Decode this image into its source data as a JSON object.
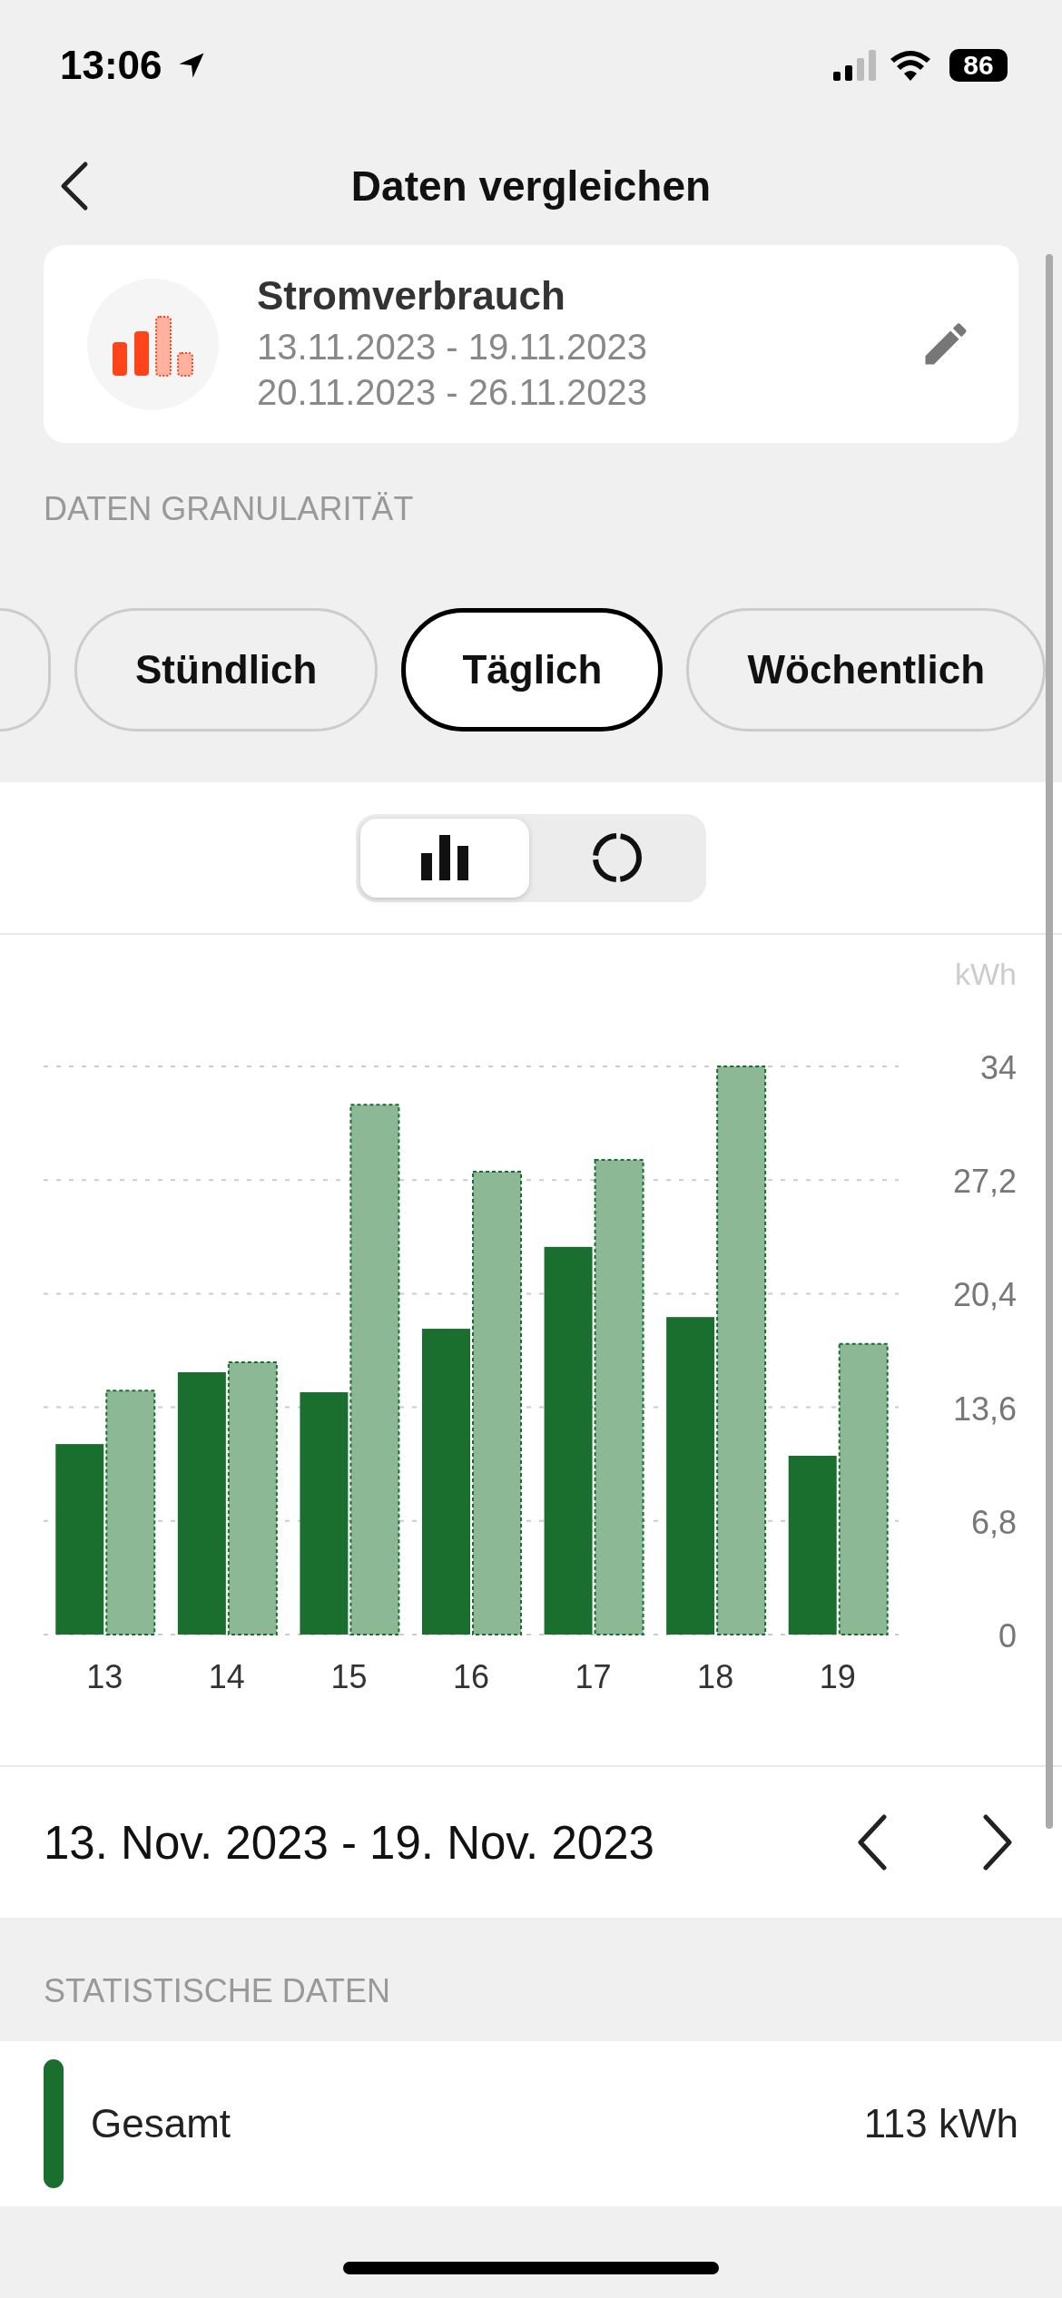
{
  "status_bar": {
    "time": "13:06",
    "battery": "86"
  },
  "nav": {
    "title": "Daten vergleichen"
  },
  "comparison": {
    "title": "Stromverbrauch",
    "periods": [
      "13.11.2023 - 19.11.2023",
      "20.11.2023 - 26.11.2023"
    ]
  },
  "granularity": {
    "label": "DATEN GRANULARITÄT",
    "options": [
      {
        "label": "Stündlich",
        "selected": false
      },
      {
        "label": "Täglich",
        "selected": true
      },
      {
        "label": "Wöchentlich",
        "selected": false
      }
    ]
  },
  "view_toggle": [
    {
      "kind": "bar",
      "selected": true
    },
    {
      "kind": "donut",
      "selected": false
    }
  ],
  "chart": {
    "chart_data": {
      "type": "bar",
      "grid": true,
      "ylabel": "kWh",
      "categories": [
        "13",
        "14",
        "15",
        "16",
        "17",
        "18",
        "19"
      ],
      "series": [
        {
          "color": "#1a6e2e",
          "values": [
            11.4,
            15.7,
            14.5,
            18.3,
            23.2,
            19.0,
            10.7
          ]
        },
        {
          "color": "#8cb896",
          "values": [
            14.6,
            16.3,
            31.7,
            27.7,
            28.4,
            34.0,
            17.4
          ]
        }
      ],
      "ylim": [
        0,
        34
      ],
      "yticks": [
        0,
        {
          "value": 6.8,
          "label": "6,8"
        },
        {
          "value": 13.6,
          "label": "13,6"
        },
        {
          "value": 20.4,
          "label": "20,4"
        },
        {
          "value": 27.2,
          "label": "27,2"
        },
        34
      ]
    }
  },
  "range": {
    "text": "13. Nov. 2023 - 19. Nov. 2023"
  },
  "statistics": {
    "label": "STATISTISCHE DATEN",
    "rows": [
      {
        "label": "Gesamt",
        "value": "113 kWh",
        "color": "#1a6e2e"
      }
    ]
  }
}
